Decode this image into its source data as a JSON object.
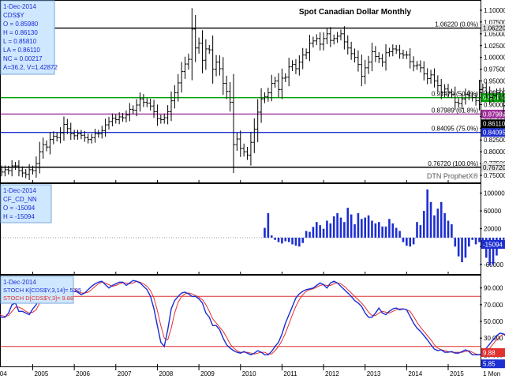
{
  "chart_data": [
    {
      "type": "line",
      "title": "Spot Canadian Dollar Monthly",
      "watermark": "DTN ProphetX®",
      "info_lines": [
        "1-Dec-2014",
        "CDS$Y",
        "O = 0.85980",
        "H = 0.86130",
        "L = 0.85810",
        "LA = 0.86110",
        "NC = 0.00217",
        "A=36.2, V=1.42872"
      ],
      "y_ticks": [
        "1.10000",
        "1.07500",
        "1.05000",
        "1.02500",
        "1.00000",
        "0.97500",
        "0.95000",
        "0.92500",
        "0.90000",
        "0.87500",
        "0.85000",
        "0.82500",
        "0.80000",
        "0.77500",
        "0.75000"
      ],
      "ylim": [
        0.74,
        1.115
      ],
      "horizontal_lines": [
        {
          "value": 1.0622,
          "label": "1.06220 (0.0%)",
          "axis_label": "1.06220",
          "color": "#000000"
        },
        {
          "value": 0.9147,
          "label": "0.91470 (50.0%)",
          "axis_label": "0.91470",
          "color": "#00a000"
        },
        {
          "value": 0.87989,
          "label": "0.87989 (61.8%)",
          "axis_label": "0.87989",
          "color": "#a0309a"
        },
        {
          "value": 0.84095,
          "label": "0.84095 (75.0%)",
          "axis_label": "0.84095",
          "color": "#1d2fd0"
        },
        {
          "value": 0.7672,
          "label": "0.76720 (100.0%)",
          "axis_label": "0.76720",
          "color": "#000000"
        }
      ],
      "last_value_label": "0.86110",
      "close_monthly": [
        0.76,
        0.765,
        0.762,
        0.757,
        0.762,
        0.76,
        0.77,
        0.77,
        0.76,
        0.755,
        0.752,
        0.762,
        0.76,
        0.775,
        0.8,
        0.815,
        0.81,
        0.826,
        0.833,
        0.83,
        0.84,
        0.858,
        0.849,
        0.838,
        0.834,
        0.838,
        0.835,
        0.83,
        0.826,
        0.83,
        0.838,
        0.838,
        0.845,
        0.857,
        0.864,
        0.871,
        0.868,
        0.874,
        0.872,
        0.878,
        0.89,
        0.888,
        0.899,
        0.912,
        0.905,
        0.903,
        0.897,
        0.885,
        0.87,
        0.868,
        0.872,
        0.885,
        0.908,
        0.925,
        0.946,
        0.97,
        0.986,
        0.996,
        1.06,
        1.02,
        1.03,
        0.994,
        1.018,
        1.016,
        0.975,
        0.99,
        0.976,
        0.945,
        0.928,
        0.905,
        0.815,
        0.827,
        0.807,
        0.8,
        0.793,
        0.82,
        0.848,
        0.884,
        0.912,
        0.917,
        0.925,
        0.945,
        0.95,
        0.932,
        0.956,
        0.958,
        0.98,
        0.985,
        0.976,
        0.99,
        1.005,
        1.01,
        1.03,
        1.035,
        1.04,
        1.028,
        1.04,
        1.05,
        1.036,
        1.04,
        1.045,
        1.05,
        1.033,
        1.02,
        1.008,
        1.0,
        0.985,
        0.96,
        0.978,
        0.99,
        1.012,
        1.002,
        0.997,
        0.99,
        1.01,
        1.012,
        1.018,
        1.016,
        1.008,
        1.005,
        1.005,
        0.991,
        0.982,
        0.984,
        0.978,
        0.965,
        0.955,
        0.963,
        0.95,
        0.94,
        0.926,
        0.933,
        0.925,
        0.922,
        0.905,
        0.902,
        0.912,
        0.922,
        0.918,
        0.915,
        0.908,
        0.932,
        0.936,
        0.926,
        0.915,
        0.92,
        0.925,
        0.918,
        0.898,
        0.89,
        0.886,
        0.875,
        0.861
      ]
    },
    {
      "type": "bar",
      "info_lines": [
        "1-Dec-2014",
        "CF_CD_NN",
        "O = -15094",
        "H = -15094"
      ],
      "y_ticks": [
        "100000",
        "60000",
        "20000",
        "-20000",
        "-60000"
      ],
      "ylim": [
        -78000,
        115000
      ],
      "last_value_label": "-15094",
      "bars_monthly": [
        22000,
        55000,
        5000,
        -5000,
        -10000,
        -13000,
        -8000,
        -10000,
        -15000,
        -18000,
        -20000,
        -12000,
        15000,
        13000,
        24000,
        35000,
        28000,
        20000,
        38000,
        32000,
        48000,
        55000,
        45000,
        35000,
        67000,
        52000,
        30000,
        55000,
        42000,
        45000,
        50000,
        38000,
        32000,
        35000,
        25000,
        25000,
        42000,
        32000,
        22000,
        15000,
        -10000,
        -18000,
        -20000,
        -15000,
        35000,
        28000,
        60000,
        108000,
        80000,
        50000,
        65000,
        80000,
        55000,
        38000,
        30000,
        -20000,
        -42000,
        -55000,
        -45000,
        -20000,
        -5000,
        -15000,
        -10000,
        -25000,
        -45000,
        -62000,
        -60000,
        -40000,
        -15000,
        -5000,
        -5000,
        18000,
        10000,
        -5000,
        -20000,
        -12000,
        -15094
      ]
    },
    {
      "type": "line",
      "info_lines": [
        "1-Dec-2014"
      ],
      "series": [
        {
          "name": "STOCH K[CDS$Y,3,14]= 5.85",
          "color": "#1a2bd6"
        },
        {
          "name": "STOCH D[CDS$Y,3]= 9.88",
          "color": "#e03030"
        }
      ],
      "y_ticks": [
        "90.000",
        "70.000",
        "50.000",
        "30.000",
        "10.000"
      ],
      "ylim": [
        -2,
        102
      ],
      "reference_lines": [
        80,
        20
      ],
      "last_value_labels": [
        "9.88",
        "5.85"
      ],
      "k_monthly": [
        65,
        60,
        58,
        55,
        55,
        60,
        70,
        72,
        62,
        62,
        60,
        58,
        65,
        70,
        80,
        88,
        90,
        92,
        95,
        92,
        96,
        97,
        93,
        88,
        86,
        85,
        82,
        84,
        88,
        92,
        95,
        97,
        98,
        94,
        90,
        93,
        95,
        97,
        97,
        93,
        96,
        99,
        98,
        96,
        92,
        88,
        80,
        65,
        45,
        25,
        20,
        40,
        65,
        75,
        80,
        84,
        85,
        83,
        80,
        80,
        77,
        72,
        60,
        55,
        45,
        45,
        40,
        30,
        22,
        18,
        15,
        13,
        12,
        14,
        12,
        10,
        12,
        15,
        13,
        10,
        10,
        14,
        20,
        25,
        35,
        48,
        58,
        68,
        78,
        83,
        86,
        88,
        89,
        90,
        93,
        96,
        94,
        90,
        96,
        98,
        96,
        92,
        88,
        84,
        80,
        75,
        72,
        68,
        60,
        55,
        55,
        60,
        66,
        60,
        58,
        62,
        65,
        66,
        64,
        65,
        64,
        56,
        48,
        42,
        38,
        33,
        28,
        22,
        17,
        15,
        16,
        13,
        13,
        14,
        12,
        12,
        14,
        16,
        14,
        10,
        10,
        10,
        13,
        18,
        23,
        28,
        33,
        36,
        35,
        31,
        29,
        24,
        19,
        13,
        9,
        7,
        5.85
      ],
      "d_monthly": [
        68,
        64,
        60,
        57,
        56,
        57,
        62,
        67,
        67,
        65,
        62,
        60,
        61,
        64,
        72,
        79,
        86,
        90,
        92,
        93,
        94,
        95,
        95,
        93,
        89,
        86,
        84,
        84,
        85,
        88,
        92,
        95,
        97,
        96,
        94,
        92,
        93,
        95,
        96,
        96,
        95,
        96,
        98,
        97,
        95,
        92,
        87,
        78,
        63,
        45,
        30,
        28,
        42,
        60,
        73,
        80,
        83,
        84,
        83,
        81,
        79,
        76,
        70,
        62,
        53,
        48,
        43,
        38,
        31,
        23,
        18,
        15,
        13,
        13,
        13,
        12,
        11,
        12,
        13,
        13,
        11,
        11,
        15,
        20,
        27,
        36,
        47,
        58,
        68,
        76,
        82,
        86,
        88,
        89,
        91,
        93,
        94,
        93,
        93,
        95,
        96,
        95,
        92,
        88,
        84,
        80,
        76,
        72,
        67,
        61,
        57,
        57,
        60,
        62,
        61,
        60,
        62,
        64,
        65,
        65,
        64,
        62,
        56,
        49,
        43,
        38,
        33,
        28,
        22,
        18,
        16,
        15,
        14,
        13,
        13,
        13,
        13,
        14,
        15,
        13,
        11,
        10,
        11,
        14,
        18,
        23,
        28,
        32,
        35,
        34,
        32,
        28,
        24,
        19,
        14,
        10,
        9.88
      ]
    }
  ],
  "x_axis": {
    "ticks": [
      {
        "label": "2004",
        "index": 0
      },
      {
        "label": "2005",
        "index": 12
      },
      {
        "label": "2006",
        "index": 24
      },
      {
        "label": "2007",
        "index": 36
      },
      {
        "label": "2008",
        "index": 48
      },
      {
        "label": "2009",
        "index": 60
      },
      {
        "label": "2010",
        "index": 72
      },
      {
        "label": "2011",
        "index": 84
      },
      {
        "label": "2012",
        "index": 96
      },
      {
        "label": "2013",
        "index": 108
      },
      {
        "label": "2014",
        "index": 120
      },
      {
        "label": "2015",
        "index": 132
      }
    ],
    "range_label": "1 Mon"
  },
  "colors": {
    "price_bars": "#000000",
    "volume_bars": "#1d2fd0",
    "info_box_bg": "#cfe8ff",
    "info_box_text": "#1a2bd6",
    "axis_label_bg": "#d8d8d8",
    "stoch_k_bg": "#1d2fd0",
    "stoch_d_bg": "#e03030"
  }
}
